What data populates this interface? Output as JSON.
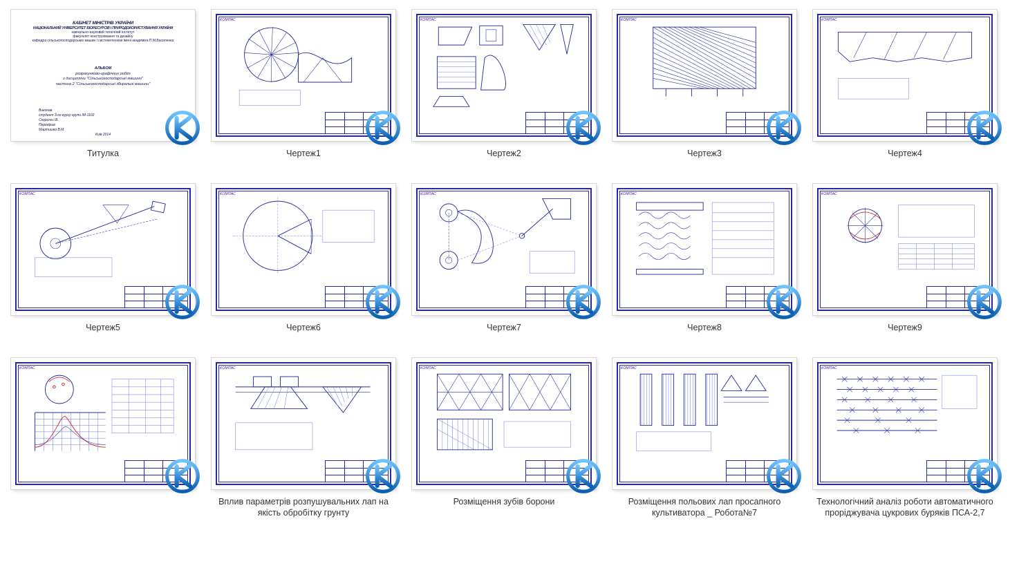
{
  "items": [
    {
      "label": "Титулка",
      "kind": "title"
    },
    {
      "label": "Чертеж1",
      "kind": "d1"
    },
    {
      "label": "Чертеж2",
      "kind": "d2"
    },
    {
      "label": "Чертеж3",
      "kind": "d3"
    },
    {
      "label": "Чертеж4",
      "kind": "d4"
    },
    {
      "label": "Чертеж5",
      "kind": "d5"
    },
    {
      "label": "Чертеж6",
      "kind": "d6"
    },
    {
      "label": "Чертеж7",
      "kind": "d7"
    },
    {
      "label": "Чертеж8",
      "kind": "d8"
    },
    {
      "label": "Чертеж9",
      "kind": "d9"
    },
    {
      "label": "",
      "kind": "d10"
    },
    {
      "label": "Вплив параметрів розпушувальних лап на якість обробітку грунту",
      "kind": "d11"
    },
    {
      "label": "Розміщення зубів борони",
      "kind": "d12"
    },
    {
      "label": "Розміщення польових лап просапного культиватора _ Робота№7",
      "kind": "d13"
    },
    {
      "label": "Технологічний аналіз роботи автоматичного проріджувача цукрових буряків ПСА-2,7",
      "kind": "d14"
    }
  ],
  "titlepage": {
    "line1": "КАБІНЕТ МІНІСТРІВ УКРАЇНИ",
    "line2": "НАЦІОНАЛЬНИЙ УНІВЕРСИТЕТ БІОРЕСУРСІВ І ПРИРОДОКОРИСТУВАННЯ УКРАЇНИ",
    "line3": "навчально-науковий технічний інститут",
    "line4": "факультет конструювання та дизайну",
    "line5": "кафедра сільськогосподарських машин і системотехніки імені академіка П.М.Василенка",
    "mid1": "АЛЬБОМ",
    "mid2": "розрахунково-графічних робіт",
    "mid3": "з дисципліни \"Сільськогосподарські машини\"",
    "mid4": "частина 2 \"Сільськогосподарські збиральні машини\"",
    "low1": "Виконав",
    "low2": "студент 3-го курсу групи ІМ-1102",
    "low3": "Скорина І.В.",
    "low4": "Перевірив",
    "low5": "Мартишко В.М.",
    "foot": "Київ 2014"
  },
  "watermark_logo": "К",
  "stamp_text": "КОМПАС"
}
